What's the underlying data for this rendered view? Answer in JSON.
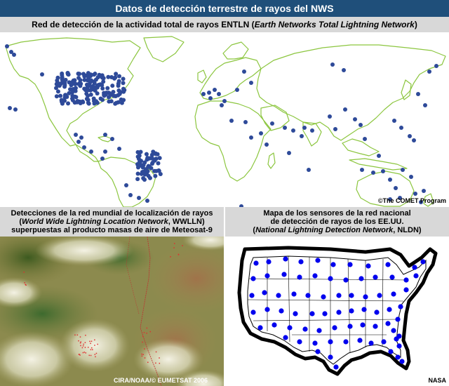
{
  "header": {
    "title": "Datos de detección terrestre de rayos del NWS"
  },
  "top_panel": {
    "title_prefix": "Red de detección de la actividad total de rayos ENTLN (",
    "title_italic": "Earth Networks Total Lightning Network",
    "title_suffix": ")",
    "credit": "©The COMET Program",
    "colors": {
      "land_outline": "#8cc63f",
      "sensor": "#2e4a99"
    }
  },
  "bottom_left_panel": {
    "line1": "Detecciones de la red mundial de localización de rayos",
    "line2_italic": "World Wide Lightning Location Network",
    "line2_suffix": ", WWLLN)",
    "line2_prefix": "(",
    "line3": "superpuestas al producto masas de aire de Meteosat-9",
    "credit": "CIRA/NOAA/© EUMETSAT 2006"
  },
  "bottom_right_panel": {
    "line1": "Mapa de los sensores de la red nacional",
    "line2": "de detección de rayos de los EE.UU.",
    "line3_prefix": "(",
    "line3_italic": "National Lightning Detection Network",
    "line3_suffix": ", NLDN)",
    "credit": "NASA",
    "colors": {
      "sensor": "#0000ee",
      "outline": "#000000"
    }
  }
}
